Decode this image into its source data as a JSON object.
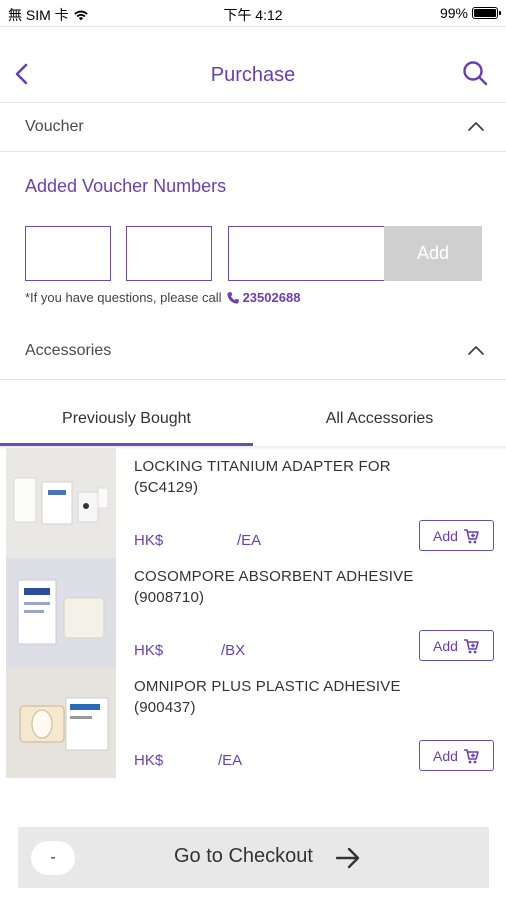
{
  "status_bar": {
    "carrier": "無 SIM 卡",
    "time": "下午 4:12",
    "battery_text": "99%",
    "battery_level": 0.99
  },
  "nav": {
    "title": "Purchase",
    "back_icon": "chevron-left-icon",
    "search_icon": "search-icon"
  },
  "voucher": {
    "section_label": "Voucher",
    "title": "Added Voucher Numbers",
    "inputs": [
      "",
      "",
      ""
    ],
    "add_label": "Add",
    "help_text": "*If you have questions, please call",
    "phone": "23502688"
  },
  "accessories": {
    "section_label": "Accessories",
    "tabs": [
      {
        "label": "Previously Bought",
        "active": true
      },
      {
        "label": "All Accessories",
        "active": false
      }
    ],
    "products": [
      {
        "name": "LOCKING TITANIUM ADAPTER FOR (5C4129)",
        "currency": "HK$",
        "unit": "/EA",
        "add_label": "Add"
      },
      {
        "name": "COSOMPORE ABSORBENT ADHESIVE (9008710)",
        "currency": "HK$",
        "unit": "/BX",
        "add_label": "Add"
      },
      {
        "name": "OMNIPOR PLUS PLASTIC ADHESIVE (900437)",
        "currency": "HK$",
        "unit": "/EA",
        "add_label": "Add"
      }
    ]
  },
  "checkout": {
    "quantity": "-",
    "label": "Go to Checkout"
  },
  "colors": {
    "accent": "#6a3fb2",
    "disabled_button": "#cfcfcf",
    "checkout_bg": "#e8e8e8"
  }
}
